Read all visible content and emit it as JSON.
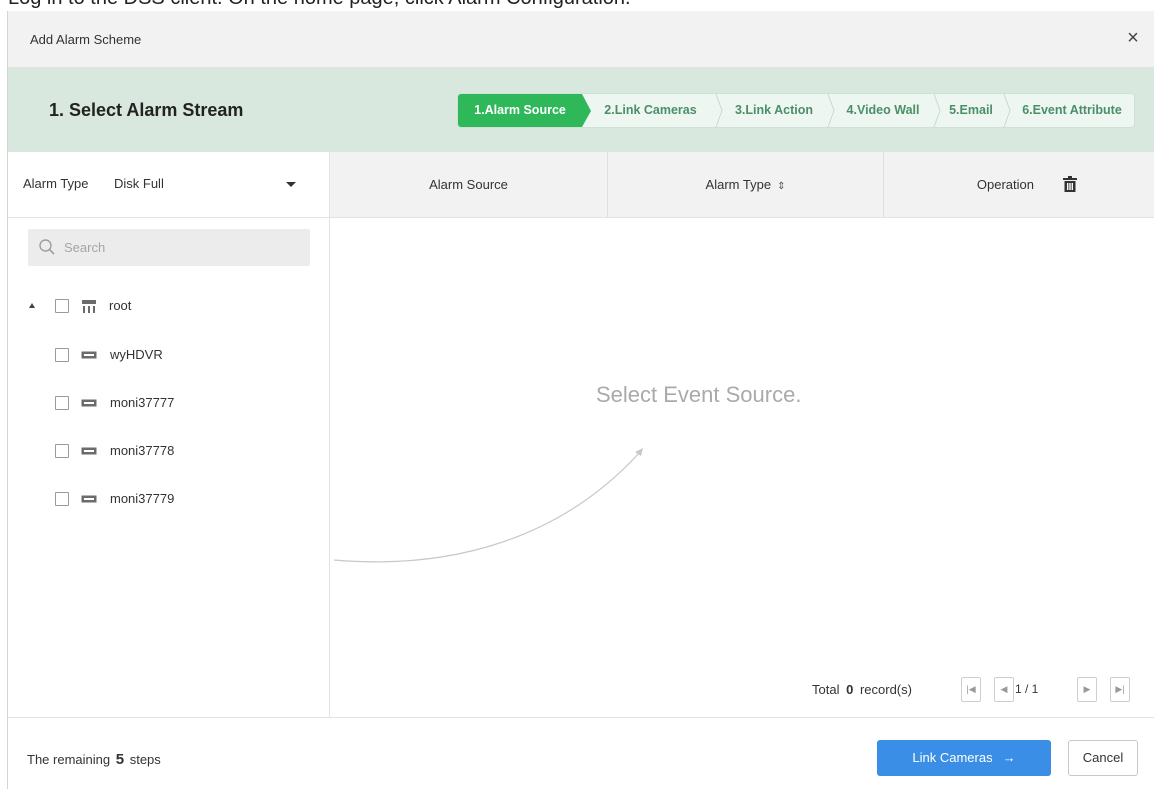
{
  "top_caption": "Log in to the DSS client. On the home page, click Alarm Configuration.",
  "dialog": {
    "title": "Add Alarm Scheme",
    "close_label": "×"
  },
  "stepbar": {
    "heading": "1.  Select Alarm Stream",
    "steps": [
      {
        "label": "1.Alarm Source",
        "active": true
      },
      {
        "label": "2.Link Cameras",
        "active": false
      },
      {
        "label": "3.Link Action",
        "active": false
      },
      {
        "label": "4.Video Wall",
        "active": false
      },
      {
        "label": "5.Email",
        "active": false
      },
      {
        "label": "6.Event Attribute",
        "active": false
      }
    ]
  },
  "left": {
    "alarm_type_label": "Alarm Type",
    "alarm_type_value": "Disk Full",
    "search_placeholder": "Search",
    "tree": {
      "root": {
        "label": "root",
        "icon": "org-icon",
        "expanded": true,
        "checked": false
      },
      "children": [
        {
          "label": "wyHDVR",
          "icon": "device-icon",
          "checked": false
        },
        {
          "label": "moni37777",
          "icon": "device-icon",
          "checked": false
        },
        {
          "label": "moni37778",
          "icon": "device-icon",
          "checked": false
        },
        {
          "label": "moni37779",
          "icon": "device-icon",
          "checked": false
        }
      ]
    }
  },
  "table": {
    "columns": [
      "Alarm Source",
      "Alarm Type",
      "Operation"
    ],
    "sort_icon": "⇕",
    "empty_text": "Select Event Source.",
    "rows": []
  },
  "pager": {
    "total_prefix": "Total",
    "total_count": "0",
    "total_suffix": "record(s)",
    "page": "1 / 1",
    "first_icon": "|◀",
    "prev_icon": "◀",
    "next_icon": "▶",
    "last_icon": "▶|"
  },
  "footer": {
    "remaining_prefix": "The remaining",
    "remaining_count": "5",
    "remaining_suffix": "steps",
    "next_label": "Link Cameras",
    "next_arrow": "→",
    "cancel_label": "Cancel"
  },
  "colors": {
    "primary_button": "#3a8ee6",
    "active_step": "#2fb85a",
    "stepbar_bg": "#d9e8df"
  }
}
